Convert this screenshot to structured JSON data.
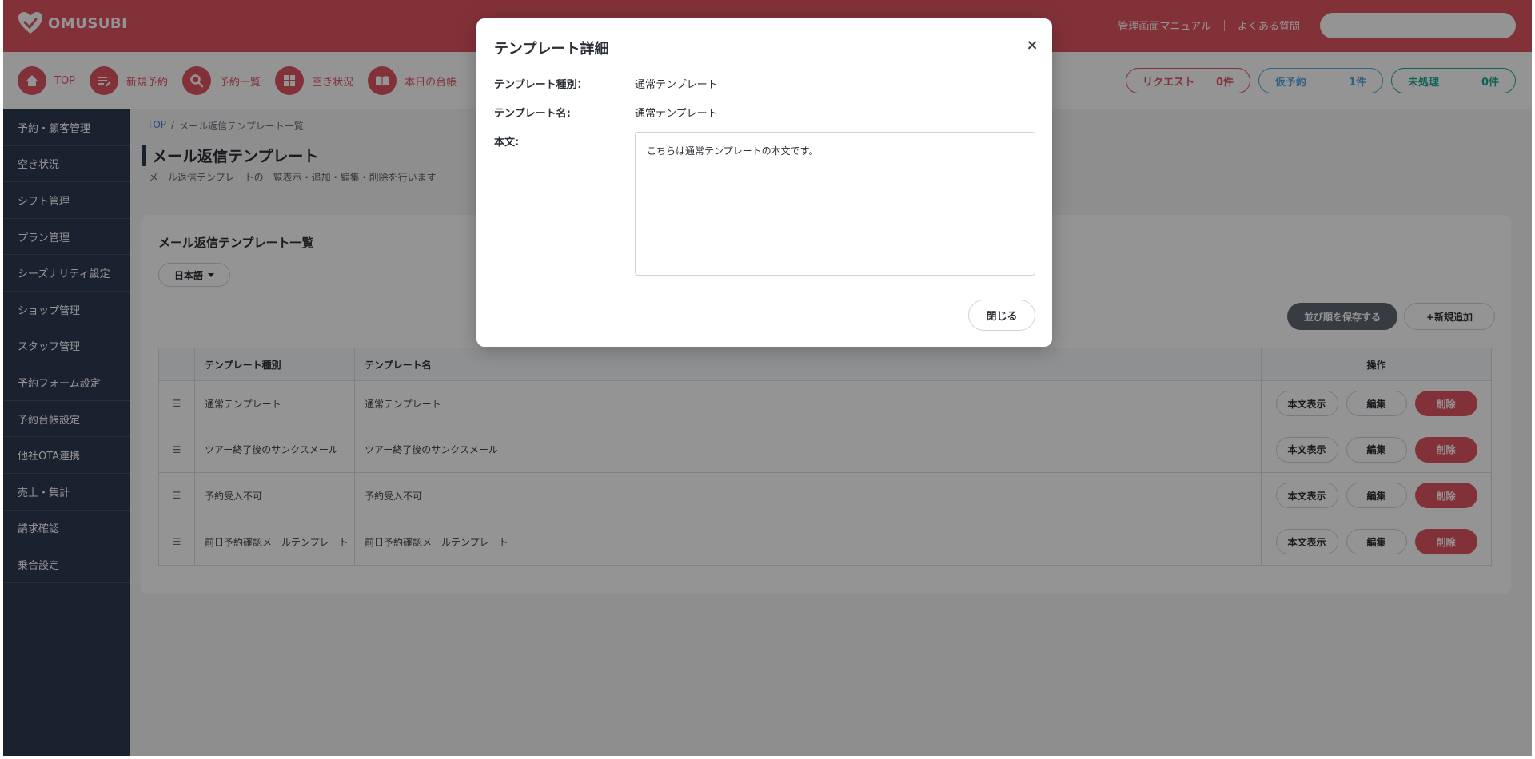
{
  "header": {
    "brand": "OMUSUBI",
    "links": [
      "管理画面マニュアル",
      "よくある質問"
    ],
    "search_placeholder": "",
    "accent": "#e25563"
  },
  "toolbar": {
    "items": [
      {
        "label": "TOP",
        "icon": "home-icon"
      },
      {
        "label": "新規予約",
        "icon": "new-reservation-icon"
      },
      {
        "label": "予約一覧",
        "icon": "search-icon"
      },
      {
        "label": "空き状況",
        "icon": "grid-icon"
      },
      {
        "label": "本日の台帳",
        "icon": "book-icon"
      }
    ],
    "pills": [
      {
        "label": "リクエスト",
        "count": "0件",
        "color": "#e25563"
      },
      {
        "label": "仮予約",
        "count": "1件",
        "color": "#5aa7dd"
      },
      {
        "label": "未処理",
        "count": "0件",
        "color": "#1fa79a"
      }
    ]
  },
  "sidebar": {
    "items": [
      {
        "label": "予約・顧客管理"
      },
      {
        "label": "空き状況"
      },
      {
        "label": "シフト管理"
      },
      {
        "label": "プラン管理"
      },
      {
        "label": "シーズナリティ設定"
      },
      {
        "label": "ショップ管理"
      },
      {
        "label": "スタッフ管理"
      },
      {
        "label": "予約フォーム設定"
      },
      {
        "label": "予約台帳設定"
      },
      {
        "label": "他社OTA連携"
      },
      {
        "label": "売上・集計"
      },
      {
        "label": "請求確認"
      },
      {
        "label": "乗合設定"
      }
    ]
  },
  "main": {
    "breadcrumb": {
      "top": "TOP",
      "sep": "/",
      "current": "メール返信テンプレート一覧"
    },
    "title": "メール返信テンプレート",
    "description": "メール返信テンプレートの一覧表示・追加・編集・削除を行います",
    "card": {
      "title": "メール返信テンプレート一覧",
      "language": "日本語",
      "save_order_label": "並び順を保存する",
      "add_label": "+新規追加",
      "table": {
        "headers": [
          "",
          "テンプレート種別",
          "テンプレート名",
          "操作"
        ],
        "handle": "☰",
        "rows": [
          {
            "type": "通常テンプレート",
            "name": "通常テンプレート"
          },
          {
            "type": "ツアー終了後のサンクスメール",
            "name": "ツアー終了後のサンクスメール"
          },
          {
            "type": "予約受入不可",
            "name": "予約受入不可"
          },
          {
            "type": "前日予約確認メールテンプレート",
            "name": "前日予約確認メールテンプレート"
          }
        ],
        "ops": {
          "view": "本文表示",
          "edit": "編集",
          "delete": "削除"
        }
      }
    }
  },
  "modal": {
    "title": "テンプレート詳細",
    "close_glyph": "×",
    "type_label": "テンプレート種別：",
    "type_value": "通常テンプレート",
    "name_label": "テンプレート名:",
    "name_value": "通常テンプレート",
    "body_label": "本文:",
    "body_value": "こちらは通常テンプレートの本文です。",
    "close_button": "閉じる"
  }
}
